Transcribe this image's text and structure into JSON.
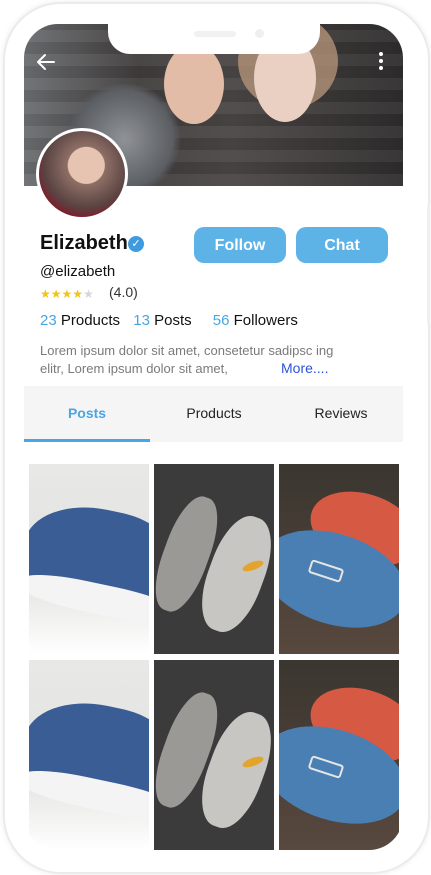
{
  "header": {
    "back_icon": "arrow-left-icon",
    "menu_icon": "more-vertical-icon"
  },
  "profile": {
    "name": "Elizabeth",
    "verified_icon": "check-badge-icon",
    "handle": "@elizabeth",
    "rating_stars": 4,
    "rating_text": "(4.0)",
    "stats": {
      "products_count": "23",
      "products_label": "Products",
      "posts_count": "13",
      "posts_label": "Posts",
      "followers_count": "56",
      "followers_label": "Followers"
    },
    "bio": "Lorem ipsum dolor sit amet, consetetur sadipsc ing elitr, Lorem ipsum dolor sit amet,",
    "more_link": "More....",
    "follow_label": "Follow",
    "chat_label": "Chat"
  },
  "tabs": [
    {
      "label": "Posts",
      "active": true
    },
    {
      "label": "Products",
      "active": false
    },
    {
      "label": "Reviews",
      "active": false
    }
  ],
  "colors": {
    "accent": "#4aa6e3",
    "button": "#5db3e6",
    "star": "#f3c315",
    "link": "#2b52d9"
  }
}
